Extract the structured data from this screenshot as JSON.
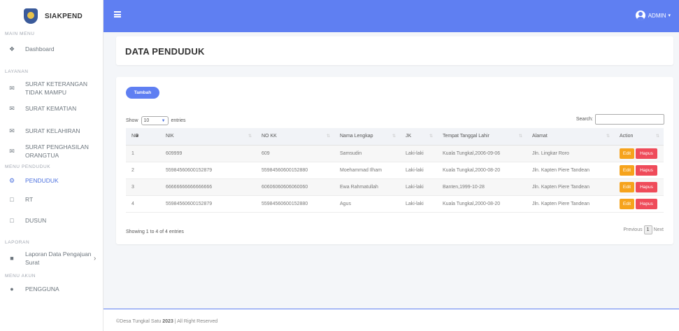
{
  "brand": {
    "name": "SIAKPEND"
  },
  "sidebar": {
    "sections": [
      {
        "heading": "MAIN MENU",
        "items": [
          {
            "label": "Dashboard",
            "icon": "home-icon"
          }
        ]
      },
      {
        "heading": "LAYANAN",
        "items": [
          {
            "label": "SURAT KETERANGAN TIDAK MAMPU",
            "icon": "envelope-icon"
          },
          {
            "label": "SURAT KEMATIAN",
            "icon": "envelope-icon"
          },
          {
            "label": "SURAT KELAHIRAN",
            "icon": "envelope-icon"
          },
          {
            "label": "SURAT PENGHASILAN ORANGTUA",
            "icon": "envelope-icon"
          }
        ]
      },
      {
        "heading": "MENU PENDUDUK",
        "items": [
          {
            "label": "PENDUDUK",
            "icon": "users-icon",
            "active": true
          },
          {
            "label": "RT",
            "icon": "square-icon"
          },
          {
            "label": "DUSUN",
            "icon": "square-icon"
          }
        ]
      },
      {
        "heading": "LAPORAN",
        "items": [
          {
            "label": "Laporan Data Pengajuan Surat",
            "icon": "book-icon"
          }
        ]
      },
      {
        "heading": "MENU AKUN",
        "items": [
          {
            "label": "PENGGUNA",
            "icon": "user-icon"
          }
        ]
      }
    ]
  },
  "topbar": {
    "user_label": "ADMIN"
  },
  "page": {
    "title": "DATA PENDUDUK"
  },
  "toolbar": {
    "add_label": "Tambah"
  },
  "table_controls": {
    "show_label": "Show",
    "entries_value": "10",
    "entries_label": "entries",
    "search_label": "Search:",
    "search_value": ""
  },
  "table": {
    "columns": [
      "NO",
      "NIK",
      "NO KK",
      "Nama Lengkap",
      "JK",
      "Tempat Tanggal Lahir",
      "Alamat",
      "Action"
    ],
    "rows": [
      {
        "no": "1",
        "nik": "609999",
        "nokk": "609",
        "nama": "Samsudin",
        "jk": "Laki-laki",
        "ttl": "Kuala Tungkal,2006-09-06",
        "alamat": "Jln. Lingkar Roro"
      },
      {
        "no": "2",
        "nik": "55984560600152879",
        "nokk": "55984560600152880",
        "nama": "Moehammad Ilham",
        "jk": "Laki-laki",
        "ttl": "Kuala Tungkal,2000-08-20",
        "alamat": "Jln. Kapten Piere Tandean"
      },
      {
        "no": "3",
        "nik": "66666666666666666",
        "nokk": "60606060606060060",
        "nama": "Ewa Rahmatullah",
        "jk": "Laki-laki",
        "ttl": "Banten,1999-10-28",
        "alamat": "Jln. Kapten Piere Tandean"
      },
      {
        "no": "4",
        "nik": "55984560600152879",
        "nokk": "55984560600152880",
        "nama": "Agus",
        "jk": "Laki-laki",
        "ttl": "Kuala Tungkal,2000-08-20",
        "alamat": "Jln. Kapten Piere Tandean"
      }
    ],
    "edit_label": "Edit",
    "delete_label": "Hapus",
    "info": "Showing 1 to 4 of 4 entries",
    "pagination": {
      "previous": "Previous",
      "current": "1",
      "next": "Next"
    }
  },
  "footer": {
    "prefix": "©Desa Tungkal Satu ",
    "year": "2023",
    "suffix": " | All Right Reserved"
  },
  "colors": {
    "accent": "#5f7ff2",
    "edit": "#f6a31c",
    "delete": "#ef4b5a"
  }
}
